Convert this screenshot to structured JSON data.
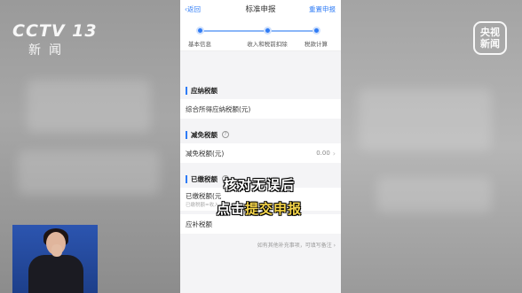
{
  "broadcast": {
    "channel_logo": "CCTV 13",
    "channel_sub": "新闻",
    "badge_line1": "央视",
    "badge_line2": "新闻"
  },
  "nav": {
    "back": "‹返回",
    "title": "标准申报",
    "refill": "重置申报"
  },
  "steps": [
    {
      "label": "基本信息"
    },
    {
      "label": "收入和税前扣除"
    },
    {
      "label": "税款计算"
    }
  ],
  "sections": {
    "payable": {
      "title": "应纳税额",
      "row_label": "综合所得应纳税额(元)"
    },
    "reduction": {
      "title": "减免税额",
      "help": "?",
      "row_label": "减免税额(元)",
      "row_value": "0.00"
    },
    "paid": {
      "title": "已缴税额",
      "help": "?",
      "row_label": "已缴税额(元",
      "row_note": "已缴税额=收入",
      "refund_label": "应补税额"
    }
  },
  "footer_note": "如有其他补充事项，可填写备注 ›",
  "subtitle": {
    "line1": "核对无误后",
    "line2_prefix": "点击",
    "line2_highlight": "提交申报"
  }
}
